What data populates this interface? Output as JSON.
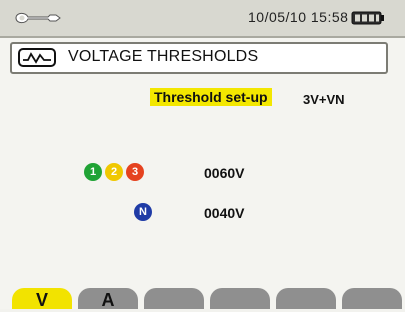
{
  "status": {
    "datetime": "10/05/10 15:58",
    "icons": [
      "wrench-icon",
      "battery-icon"
    ]
  },
  "header": {
    "title": "VOLTAGE THRESHOLDS",
    "icon": "threshold-icon"
  },
  "threshold_setup": {
    "label": "Threshold set-up",
    "value": "3V+VN"
  },
  "phases": [
    {
      "label": "1",
      "color": "#20a335"
    },
    {
      "label": "2",
      "color": "#f0c800"
    },
    {
      "label": "3",
      "color": "#e5421f"
    }
  ],
  "neutral": {
    "label": "N",
    "color": "#1f3ba6"
  },
  "thresholds": {
    "phase_value": "0060V",
    "neutral_value": "0040V"
  },
  "tabs": [
    {
      "label": "V",
      "active": true
    },
    {
      "label": "A",
      "active": false
    },
    {
      "label": "",
      "active": false
    },
    {
      "label": "",
      "active": false
    },
    {
      "label": "",
      "active": false
    },
    {
      "label": "",
      "active": false
    }
  ],
  "colors": {
    "highlight_yellow": "#f3e700",
    "tab_grey": "#8f8f8f"
  }
}
